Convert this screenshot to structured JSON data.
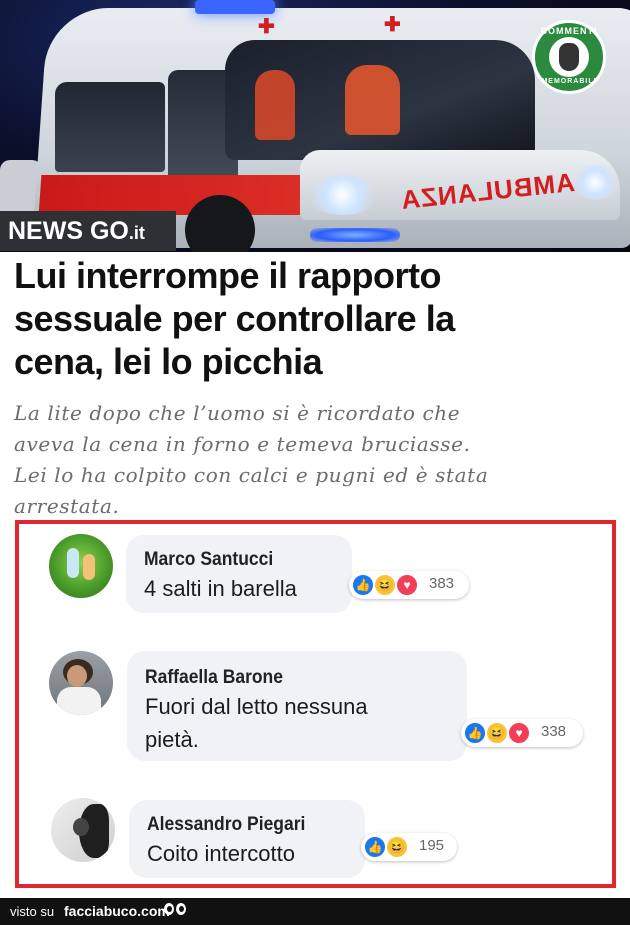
{
  "hero": {
    "ambulance_text": "AMBULANZA",
    "watermark_badge": {
      "top_text": "COMMENTI",
      "bottom_text": "MEMORABILI",
      "color": "#2b8a3e"
    },
    "news_brand": {
      "main": "NEWS GO",
      "suffix": ".it"
    }
  },
  "article": {
    "headline_lines": [
      "Lui interrompe il rapporto",
      "sessuale per controllare la",
      "cena, lei lo picchia"
    ],
    "subtitle_lines": [
      "La lite dopo che l’uomo si è ricordato che",
      "aveva la cena in forno e temeva bruciasse.",
      "Lei lo ha colpito con calci e pugni ed è stata",
      "arrestata."
    ]
  },
  "comments_box": {
    "border_color": "#e0262f"
  },
  "comments": [
    {
      "author": "Marco Santucci",
      "text_lines": [
        "4 salti in barella"
      ],
      "reactions": [
        "like",
        "haha",
        "love"
      ],
      "count": "383"
    },
    {
      "author": "Raffaella Barone",
      "text_lines": [
        "Fuori dal letto nessuna",
        "pietà."
      ],
      "reactions": [
        "like",
        "haha",
        "love"
      ],
      "count": "338"
    },
    {
      "author": "Alessandro Piegari",
      "text_lines": [
        "Coito intercotto"
      ],
      "reactions": [
        "like",
        "haha"
      ],
      "count": "195"
    }
  ],
  "footer": {
    "visto": "visto su",
    "site": "facciabuco.com"
  },
  "colors": {
    "like": "#1877f2",
    "haha": "#f7c33b",
    "love": "#f33e58",
    "footer_bg": "#111111"
  }
}
